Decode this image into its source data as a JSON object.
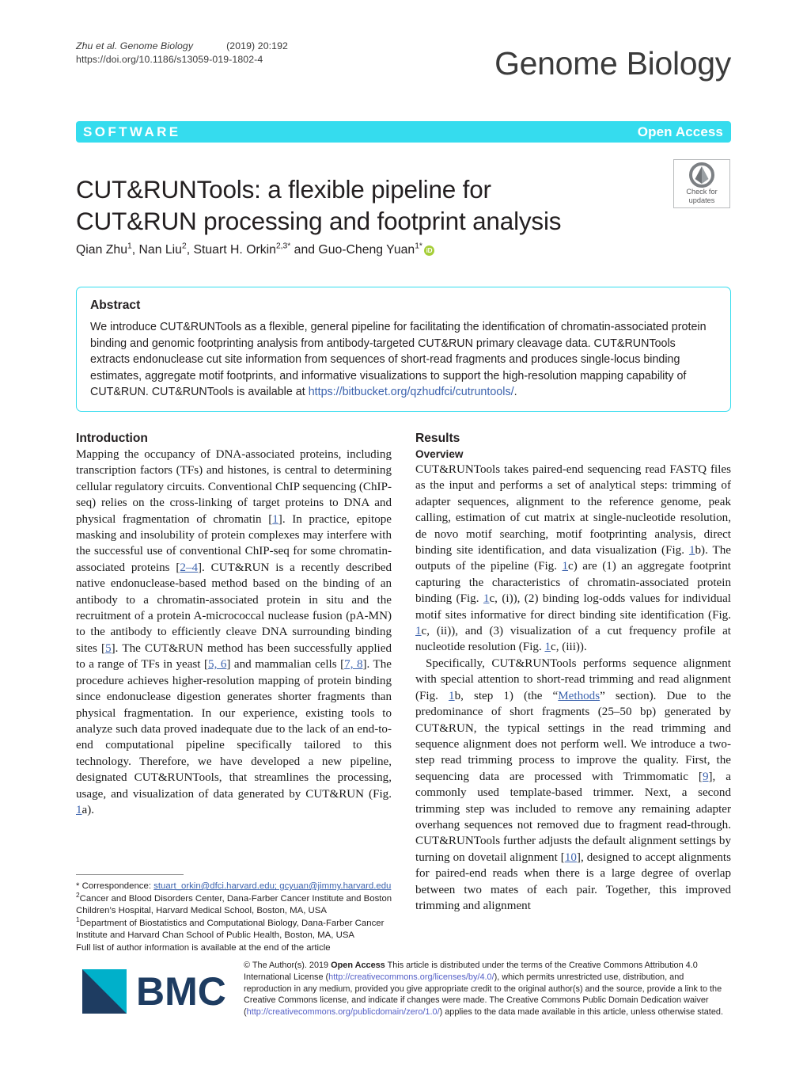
{
  "colors": {
    "accent_cyan": "#35dcee",
    "link_blue": "#3c63ae",
    "footer_link": "#5560c7",
    "orcid_green": "#a6ce39",
    "bmc_navy": "#1e3c61",
    "bmc_cyan": "#00b0ca",
    "text": "#231f20"
  },
  "running_head": {
    "citation": "Zhu et al. Genome Biology",
    "volume": "(2019) 20:192",
    "doi": "https://doi.org/10.1186/s13059-019-1802-4"
  },
  "journal": {
    "logo_text": "Genome Biology"
  },
  "banner": {
    "article_type": "SOFTWARE",
    "access_type": "Open Access"
  },
  "title": "CUT&RUNTools: a flexible pipeline for CUT&RUN processing and footprint analysis",
  "crossmark": {
    "label_line1": "Check for",
    "label_line2": "updates",
    "icon": "crossmark-icon"
  },
  "authors": {
    "list": [
      {
        "name": "Qian Zhu",
        "sup": "1",
        "sep": ", "
      },
      {
        "name": "Nan Liu",
        "sup": "2",
        "sep": ", "
      },
      {
        "name": "Stuart H. Orkin",
        "sup": "2,3*",
        "sep": " and "
      },
      {
        "name": "Guo-Cheng Yuan",
        "sup": "1*",
        "sep": ""
      }
    ],
    "orcid_glyph": "iD"
  },
  "abstract": {
    "heading": "Abstract",
    "text_before_link": "We introduce CUT&RUNTools as a flexible, general pipeline for facilitating the identification of chromatin-associated protein binding and genomic footprinting analysis from antibody-targeted CUT&RUN primary cleavage data. CUT&RUNTools extracts endonuclease cut site information from sequences of short-read fragments and produces single-locus binding estimates, aggregate motif footprints, and informative visualizations to support the high-resolution mapping capability of CUT&RUN. CUT&RUNTools is available at ",
    "link_text": "https://bitbucket.org/qzhudfci/cutruntools/",
    "text_after_link": "."
  },
  "left_column": {
    "heading": "Introduction",
    "paragraph_1": {
      "part_1": "Mapping the occupancy of DNA-associated proteins, including transcription factors (TFs) and histones, is central to determining cellular regulatory circuits. Conventional ChIP sequencing (ChIP-seq) relies on the cross-linking of target proteins to DNA and physical fragmentation of chromatin [",
      "ref_1": "1",
      "part_2": "]. In practice, epitope masking and insolubility of protein complexes may interfere with the successful use of conventional ChIP-seq for some chromatin-associated proteins [",
      "ref_2": "2–4",
      "part_3": "]. CUT&RUN is a recently described native endonuclease-based method based on the binding of an antibody to a chromatin-associated protein in situ and the recruitment of a protein A-micrococcal nuclease fusion (pA-MN) to the antibody to efficiently cleave DNA surrounding binding sites [",
      "ref_3": "5",
      "part_4": "]. The CUT&RUN method has been successfully applied to a range of TFs in yeast [",
      "ref_4": "5, 6",
      "part_5": "] and mammalian cells [",
      "ref_5": "7, 8",
      "part_6": "]. The procedure achieves higher-resolution mapping of protein binding since endonuclease digestion generates shorter fragments than physical fragmentation. In our experience, existing tools to analyze such data proved inadequate due to the lack of an end-to-end computational pipeline specifically tailored to this technology. Therefore, we have developed a new pipeline, designated CUT&RUNTools, that streamlines the processing, usage, and visualization of data generated by CUT&RUN (Fig. ",
      "ref_6": "1",
      "part_7": "a)."
    }
  },
  "right_column": {
    "heading": "Results",
    "subheading": "Overview",
    "paragraph_1": {
      "part_1": "CUT&RUNTools takes paired-end sequencing read FASTQ files as the input and performs a set of analytical steps: trimming of adapter sequences, alignment to the reference genome, peak calling, estimation of cut matrix at single-nucleotide resolution, de novo motif searching, motif footprinting analysis, direct binding site identification, and data visualization (Fig. ",
      "ref_1": "1",
      "part_2": "b). The outputs of the pipeline (Fig. ",
      "ref_2": "1",
      "part_3": "c) are (1) an aggregate footprint capturing the characteristics of chromatin-associated protein binding (Fig. ",
      "ref_3": "1",
      "part_4": "c, (i)), (2) binding log-odds values for individual motif sites informative for direct binding site identification (Fig. ",
      "ref_4": "1",
      "part_5": "c, (ii)), and (3) visualization of a cut frequency profile at nucleotide resolution (Fig. ",
      "ref_5": "1",
      "part_6": "c, (iii))."
    },
    "paragraph_2": {
      "part_1": "Specifically, CUT&RUNTools performs sequence alignment with special attention to short-read trimming and read alignment (Fig. ",
      "ref_1": "1",
      "part_2": "b, step 1) (the “",
      "ref_2": "Methods",
      "part_3": "” section). Due to the predominance of short fragments (25–50 bp) generated by CUT&RUN, the typical settings in the read trimming and sequence alignment does not perform well. We introduce a two-step read trimming process to improve the quality. First, the sequencing data are processed with Trimmomatic [",
      "ref_3": "9",
      "part_4": "], a commonly used template-based trimmer. Next, a second trimming step was included to remove any remaining adapter overhang sequences not removed due to fragment read-through. CUT&RUNTools further adjusts the default alignment settings by turning on dovetail alignment [",
      "ref_4": "10",
      "part_5": "], designed to accept alignments for paired-end reads when there is a large degree of overlap between two mates of each pair. Together, this improved trimming and alignment"
    }
  },
  "correspondence": {
    "label": "* Correspondence: ",
    "emails": "stuart_orkin@dfci.harvard.edu; gcyuan@jimmy.harvard.edu",
    "affiliation_2_sup": "2",
    "affiliation_2": "Cancer and Blood Disorders Center, Dana-Farber Cancer Institute and Boston Children’s Hospital, Harvard Medical School, Boston, MA, USA",
    "affiliation_1_sup": "1",
    "affiliation_1": "Department of Biostatistics and Computational Biology, Dana-Farber Cancer Institute and Harvard Chan School of Public Health, Boston, MA, USA",
    "full_list_note": "Full list of author information is available at the end of the article"
  },
  "footer": {
    "logo_text": "BMC",
    "copyright": {
      "part_1": "© The Author(s). 2019 ",
      "open_access": "Open Access",
      "part_2": " This article is distributed under the terms of the Creative Commons Attribution 4.0 International License (",
      "link_1": "http://creativecommons.org/licenses/by/4.0/",
      "part_3": "), which permits unrestricted use, distribution, and reproduction in any medium, provided you give appropriate credit to the original author(s) and the source, provide a link to the Creative Commons license, and indicate if changes were made. The Creative Commons Public Domain Dedication waiver (",
      "link_2": "http://creativecommons.org/publicdomain/zero/1.0/",
      "part_4": ") applies to the data made available in this article, unless otherwise stated."
    }
  }
}
